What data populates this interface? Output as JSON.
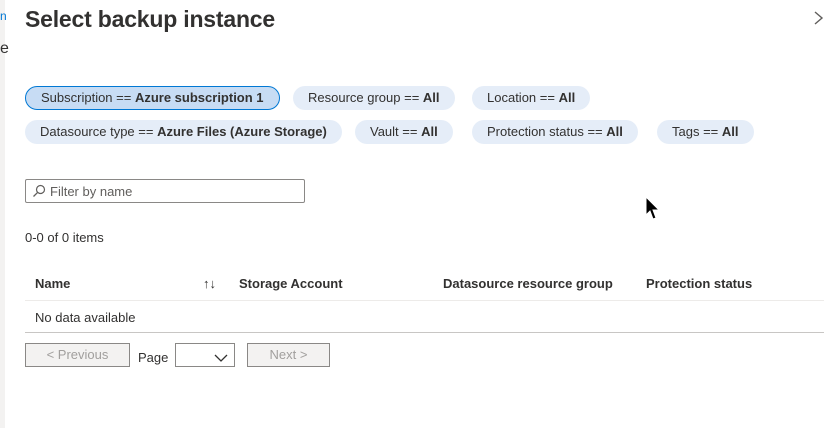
{
  "edge": {
    "glyph_top": "n",
    "glyph_bottom": "e"
  },
  "panel": {
    "title": "Select backup instance",
    "close_icon": "close-icon"
  },
  "filters": [
    {
      "key": "Subscription == ",
      "value": "Azure subscription 1",
      "active": true
    },
    {
      "key": "Resource group == ",
      "value": "All"
    },
    {
      "key": "Location == ",
      "value": "All"
    },
    {
      "key": "Datasource type == ",
      "value": "Azure Files (Azure Storage)"
    },
    {
      "key": "Vault == ",
      "value": "All"
    },
    {
      "key": "Protection status == ",
      "value": "All"
    },
    {
      "key": "Tags == ",
      "value": "All"
    }
  ],
  "search": {
    "placeholder": "Filter by name",
    "value": "",
    "icon": "search-icon"
  },
  "summary": {
    "count_text": "0-0 of 0 items"
  },
  "table": {
    "columns": [
      "Name",
      "Storage Account",
      "Datasource resource group",
      "Protection status"
    ],
    "sort_glyph": "↑↓",
    "empty_text": "No data available"
  },
  "pagination": {
    "previous_label": "< Previous",
    "page_label": "Page",
    "page_value": "",
    "next_label": "Next >"
  },
  "colors": {
    "accent": "#0078d4",
    "pill_bg": "#e5edf8",
    "pill_active_bg": "#c7dcf4"
  }
}
